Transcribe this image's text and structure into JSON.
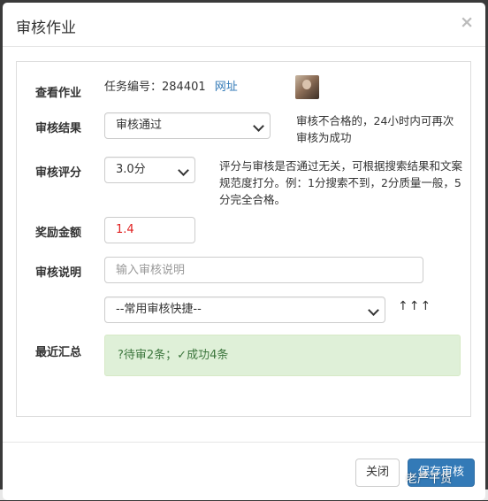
{
  "modal": {
    "title": "审核作业",
    "close_symbol": "×"
  },
  "form": {
    "view_task": {
      "label": "查看作业",
      "task_number_text": "任务编号：284401",
      "link_text": "网址"
    },
    "review_result": {
      "label": "审核结果",
      "selected": "审核通过",
      "hint": "审核不合格的，24小时内可再次审核为成功"
    },
    "review_score": {
      "label": "审核评分",
      "selected": "3.0分",
      "hint": "评分与审核是否通过无关，可根据搜索结果和文案规范度打分。例：1分搜索不到，2分质量一般，5分完全合格。"
    },
    "reward_amount": {
      "label": "奖励金额",
      "value": "1.4",
      "value_color": "#e02020"
    },
    "review_note": {
      "label": "审核说明",
      "placeholder": "输入审核说明"
    },
    "quick_review": {
      "selected": "--常用审核快捷--",
      "arrows": "↑↑↑"
    },
    "recent_summary": {
      "label": "最近汇总",
      "text": "?待审2条；✓成功4条"
    }
  },
  "footer": {
    "close_label": "关闭",
    "save_label": "保存审核"
  },
  "watermark": "老严干货",
  "colors": {
    "primary": "#337ab7",
    "success_bg": "#dff0d8",
    "success_text": "#3c763d",
    "link": "#337ab7"
  }
}
